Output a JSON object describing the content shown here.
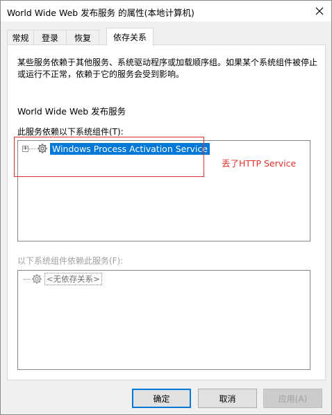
{
  "window": {
    "title": "World Wide Web 发布服务 的属性(本地计算机)"
  },
  "tabs": [
    {
      "label": "常规",
      "active": false
    },
    {
      "label": "登录",
      "active": false
    },
    {
      "label": "恢复",
      "active": false
    },
    {
      "label": "依存关系",
      "active": true
    }
  ],
  "panel": {
    "description": "某些服务依赖于其他服务、系统驱动程序或加载顺序组。如果某个系统组件被停止或运行不正常，依赖于它的服务会受到影响。",
    "service_name": "World Wide Web 发布服务",
    "depends_on_label": "此服务依赖以下系统组件(T):",
    "depends_on_items": [
      "Windows Process Activation Service"
    ],
    "dependents_label": "以下系统组件依赖此服务(F):",
    "dependents_items": [
      "<无依存关系>"
    ]
  },
  "annotation": {
    "text": "丢了HTTP Service",
    "color": "#e0302a"
  },
  "buttons": {
    "ok": "确定",
    "cancel": "取消",
    "apply": "应用(A)"
  },
  "colors": {
    "selection": "#0078d7",
    "annotation_red": "#e0302a"
  }
}
